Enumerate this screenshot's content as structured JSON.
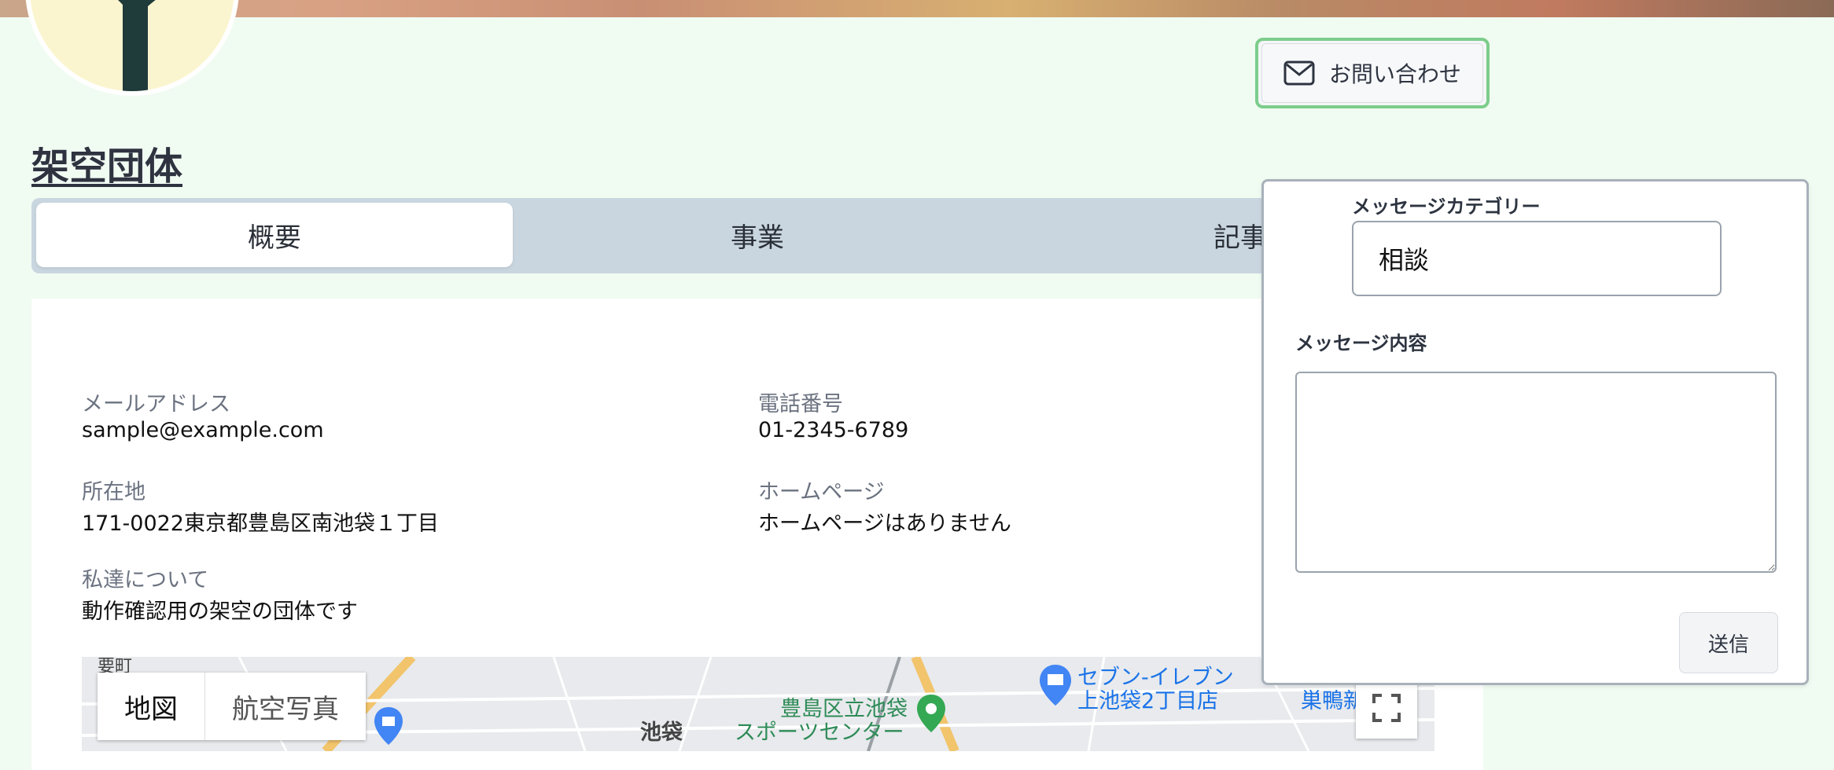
{
  "header": {
    "contact_button_label": "お問い合わせ",
    "org_name": "架空団体"
  },
  "tabs": [
    {
      "label": "概要",
      "active": true
    },
    {
      "label": "事業",
      "active": false
    },
    {
      "label": "記事",
      "active": false
    }
  ],
  "overview": {
    "email_label": "メールアドレス",
    "email_value": "sample@example.com",
    "phone_label": "電話番号",
    "phone_value": "01-2345-6789",
    "address_label": "所在地",
    "address_value": "171-0022東京都豊島区南池袋１丁目",
    "homepage_label": "ホームページ",
    "homepage_value": "ホームページはありません",
    "about_label": "私達について",
    "about_value": "動作確認用の架空の団体です"
  },
  "map": {
    "toggle_map": "地図",
    "toggle_satellite": "航空写真",
    "labels": {
      "ikebukuro": "池袋",
      "sports_center_1": "豊島区立池袋",
      "sports_center_2": "スポーツセンター",
      "seven_1": "セブン-イレブン",
      "seven_2": "上池袋2丁目店",
      "sugamo": "巣鴨新",
      "top_left": "要町"
    }
  },
  "contact_form": {
    "category_label": "メッセージカテゴリー",
    "category_value": "相談",
    "content_label": "メッセージ内容",
    "content_value": "",
    "send_label": "送信"
  },
  "colors": {
    "background": "#f0fbf2",
    "tab_bar": "#c9d6e0",
    "contact_border": "#7ccd8b"
  }
}
